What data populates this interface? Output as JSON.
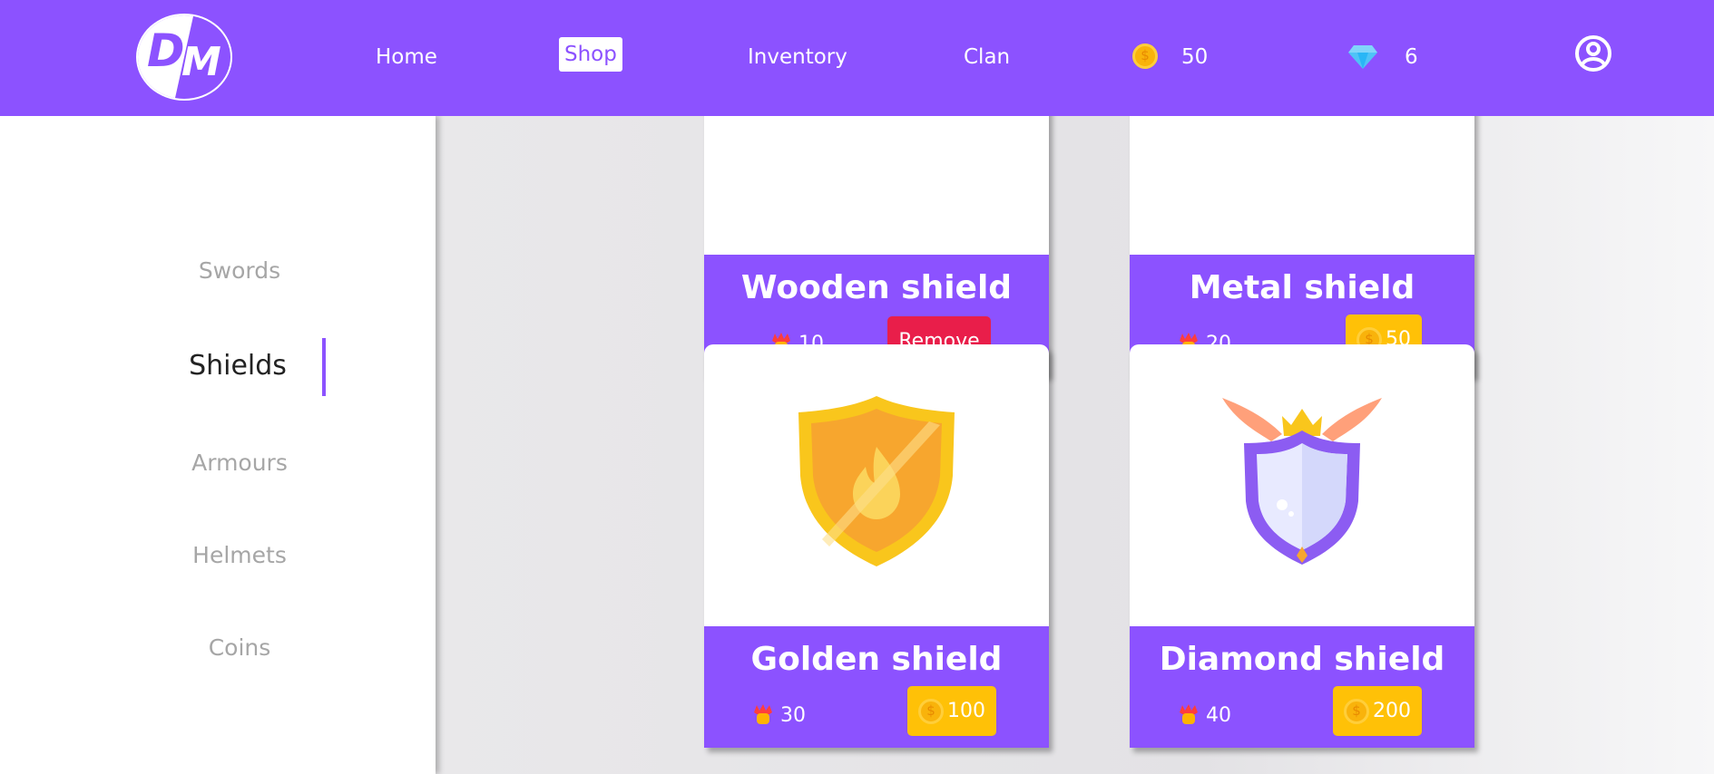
{
  "nav": {
    "home": "Home",
    "shop": "Shop",
    "inventory": "Inventory",
    "clan": "Clan",
    "coins": "50",
    "diamonds": "6"
  },
  "sidebar": {
    "items": [
      {
        "label": "Swords"
      },
      {
        "label": "Shields"
      },
      {
        "label": "Armours"
      },
      {
        "label": "Helmets"
      },
      {
        "label": "Coins"
      }
    ],
    "active": "Shields"
  },
  "items": [
    {
      "name": "Wooden shield",
      "power": "10",
      "action": "Remove"
    },
    {
      "name": "Metal shield",
      "power": "20",
      "price": "50"
    },
    {
      "name": "Golden shield",
      "power": "30",
      "price": "100"
    },
    {
      "name": "Diamond shield",
      "power": "40",
      "price": "200"
    }
  ],
  "colors": {
    "brand": "#8c52ff",
    "price": "#ffc107",
    "remove": "#e91e4a"
  },
  "icons": [
    "coin-icon",
    "diamond-icon",
    "profile-icon",
    "fist-icon",
    "golden-shield-icon",
    "diamond-shield-icon"
  ]
}
